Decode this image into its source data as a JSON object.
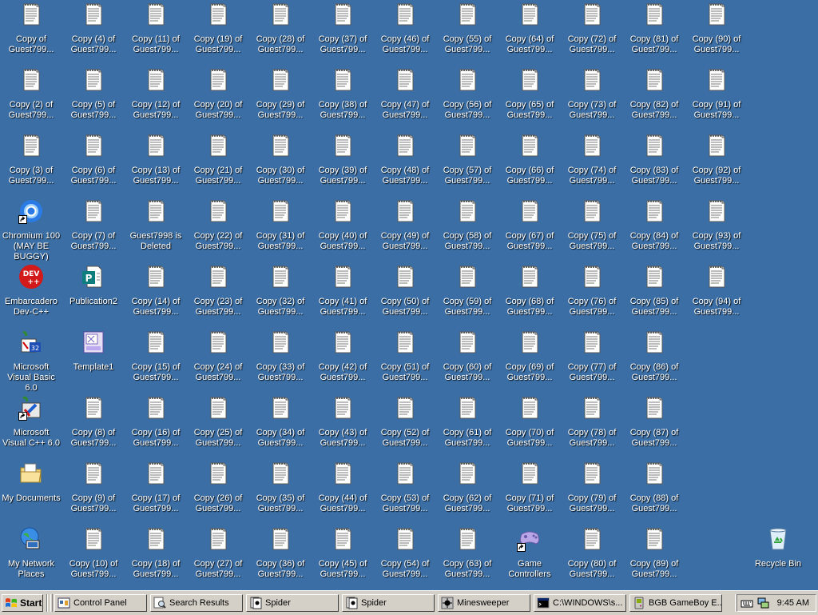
{
  "desktop": {
    "columns": [
      [
        {
          "label": "Copy of Guest799...",
          "icon": "notepad-document-icon"
        },
        {
          "label": "Copy (2) of Guest799...",
          "icon": "notepad-document-icon"
        },
        {
          "label": "Copy (3) of Guest799...",
          "icon": "notepad-document-icon"
        },
        {
          "label": "Chromium 100 (MAY BE BUGGY)",
          "icon": "chromium-icon",
          "shortcut": true
        },
        {
          "label": "Embarcadero Dev-C++",
          "icon": "dev-cpp-icon"
        },
        {
          "label": "Microsoft Visual Basic 6.0",
          "icon": "visual-basic-icon"
        },
        {
          "label": "Microsoft Visual C++ 6.0",
          "icon": "visual-cpp-icon",
          "shortcut": true
        },
        {
          "label": "My Documents",
          "icon": "my-documents-icon"
        },
        {
          "label": "My Network Places",
          "icon": "network-places-icon"
        }
      ],
      [
        {
          "label": "Copy (4) of Guest799...",
          "icon": "notepad-document-icon"
        },
        {
          "label": "Copy (5) of Guest799...",
          "icon": "notepad-document-icon"
        },
        {
          "label": "Copy (6) of Guest799...",
          "icon": "notepad-document-icon"
        },
        {
          "label": "Copy (7) of Guest799...",
          "icon": "notepad-document-icon"
        },
        {
          "label": "Publication2",
          "icon": "publisher-document-icon"
        },
        {
          "label": "Template1",
          "icon": "template-icon"
        },
        {
          "label": "Copy (8) of Guest799...",
          "icon": "notepad-document-icon"
        },
        {
          "label": "Copy (9) of Guest799...",
          "icon": "notepad-document-icon"
        },
        {
          "label": "Copy (10) of Guest799...",
          "icon": "notepad-document-icon"
        }
      ],
      [
        {
          "label": "Copy (11) of Guest799...",
          "icon": "notepad-document-icon"
        },
        {
          "label": "Copy (12) of Guest799...",
          "icon": "notepad-document-icon"
        },
        {
          "label": "Copy (13) of Guest799...",
          "icon": "notepad-document-icon"
        },
        {
          "label": "Guest7998 is Deleted",
          "icon": "notepad-document-icon"
        },
        {
          "label": "Copy (14) of Guest799...",
          "icon": "notepad-document-icon"
        },
        {
          "label": "Copy (15) of Guest799...",
          "icon": "notepad-document-icon"
        },
        {
          "label": "Copy (16) of Guest799...",
          "icon": "notepad-document-icon"
        },
        {
          "label": "Copy (17) of Guest799...",
          "icon": "notepad-document-icon"
        },
        {
          "label": "Copy (18) of Guest799...",
          "icon": "notepad-document-icon"
        }
      ],
      [
        {
          "label": "Copy (19) of Guest799...",
          "icon": "notepad-document-icon"
        },
        {
          "label": "Copy (20) of Guest799...",
          "icon": "notepad-document-icon"
        },
        {
          "label": "Copy (21) of Guest799...",
          "icon": "notepad-document-icon"
        },
        {
          "label": "Copy (22) of Guest799...",
          "icon": "notepad-document-icon"
        },
        {
          "label": "Copy (23) of Guest799...",
          "icon": "notepad-document-icon"
        },
        {
          "label": "Copy (24) of Guest799...",
          "icon": "notepad-document-icon"
        },
        {
          "label": "Copy (25) of Guest799...",
          "icon": "notepad-document-icon"
        },
        {
          "label": "Copy (26) of Guest799...",
          "icon": "notepad-document-icon"
        },
        {
          "label": "Copy (27) of Guest799...",
          "icon": "notepad-document-icon"
        }
      ],
      [
        {
          "label": "Copy (28) of Guest799...",
          "icon": "notepad-document-icon"
        },
        {
          "label": "Copy (29) of Guest799...",
          "icon": "notepad-document-icon"
        },
        {
          "label": "Copy (30) of Guest799...",
          "icon": "notepad-document-icon"
        },
        {
          "label": "Copy (31) of Guest799...",
          "icon": "notepad-document-icon"
        },
        {
          "label": "Copy (32) of Guest799...",
          "icon": "notepad-document-icon"
        },
        {
          "label": "Copy (33) of Guest799...",
          "icon": "notepad-document-icon"
        },
        {
          "label": "Copy (34) of Guest799...",
          "icon": "notepad-document-icon"
        },
        {
          "label": "Copy (35) of Guest799...",
          "icon": "notepad-document-icon"
        },
        {
          "label": "Copy (36) of Guest799...",
          "icon": "notepad-document-icon"
        }
      ],
      [
        {
          "label": "Copy (37) of Guest799...",
          "icon": "notepad-document-icon"
        },
        {
          "label": "Copy (38) of Guest799...",
          "icon": "notepad-document-icon"
        },
        {
          "label": "Copy (39) of Guest799...",
          "icon": "notepad-document-icon"
        },
        {
          "label": "Copy (40) of Guest799...",
          "icon": "notepad-document-icon"
        },
        {
          "label": "Copy (41) of Guest799...",
          "icon": "notepad-document-icon"
        },
        {
          "label": "Copy (42) of Guest799...",
          "icon": "notepad-document-icon"
        },
        {
          "label": "Copy (43) of Guest799...",
          "icon": "notepad-document-icon"
        },
        {
          "label": "Copy (44) of Guest799...",
          "icon": "notepad-document-icon"
        },
        {
          "label": "Copy (45) of Guest799...",
          "icon": "notepad-document-icon"
        }
      ],
      [
        {
          "label": "Copy (46) of Guest799...",
          "icon": "notepad-document-icon"
        },
        {
          "label": "Copy (47) of Guest799...",
          "icon": "notepad-document-icon"
        },
        {
          "label": "Copy (48) of Guest799...",
          "icon": "notepad-document-icon"
        },
        {
          "label": "Copy (49) of Guest799...",
          "icon": "notepad-document-icon"
        },
        {
          "label": "Copy (50) of Guest799...",
          "icon": "notepad-document-icon"
        },
        {
          "label": "Copy (51) of Guest799...",
          "icon": "notepad-document-icon"
        },
        {
          "label": "Copy (52) of Guest799...",
          "icon": "notepad-document-icon"
        },
        {
          "label": "Copy (53) of Guest799...",
          "icon": "notepad-document-icon"
        },
        {
          "label": "Copy (54) of Guest799...",
          "icon": "notepad-document-icon"
        }
      ],
      [
        {
          "label": "Copy (55) of Guest799...",
          "icon": "notepad-document-icon"
        },
        {
          "label": "Copy (56) of Guest799...",
          "icon": "notepad-document-icon"
        },
        {
          "label": "Copy (57) of Guest799...",
          "icon": "notepad-document-icon"
        },
        {
          "label": "Copy (58) of Guest799...",
          "icon": "notepad-document-icon"
        },
        {
          "label": "Copy (59) of Guest799...",
          "icon": "notepad-document-icon"
        },
        {
          "label": "Copy (60) of Guest799...",
          "icon": "notepad-document-icon"
        },
        {
          "label": "Copy (61) of Guest799...",
          "icon": "notepad-document-icon"
        },
        {
          "label": "Copy (62) of Guest799...",
          "icon": "notepad-document-icon"
        },
        {
          "label": "Copy (63) of Guest799...",
          "icon": "notepad-document-icon"
        }
      ],
      [
        {
          "label": "Copy (64) of Guest799...",
          "icon": "notepad-document-icon"
        },
        {
          "label": "Copy (65) of Guest799...",
          "icon": "notepad-document-icon"
        },
        {
          "label": "Copy (66) of Guest799...",
          "icon": "notepad-document-icon"
        },
        {
          "label": "Copy (67) of Guest799...",
          "icon": "notepad-document-icon"
        },
        {
          "label": "Copy (68) of Guest799...",
          "icon": "notepad-document-icon"
        },
        {
          "label": "Copy (69) of Guest799...",
          "icon": "notepad-document-icon"
        },
        {
          "label": "Copy (70) of Guest799...",
          "icon": "notepad-document-icon"
        },
        {
          "label": "Copy (71) of Guest799...",
          "icon": "notepad-document-icon"
        },
        {
          "label": "Game Controllers",
          "icon": "game-controller-icon",
          "shortcut": true
        }
      ],
      [
        {
          "label": "Copy (72) of Guest799...",
          "icon": "notepad-document-icon"
        },
        {
          "label": "Copy (73) of Guest799...",
          "icon": "notepad-document-icon"
        },
        {
          "label": "Copy (74) of Guest799...",
          "icon": "notepad-document-icon"
        },
        {
          "label": "Copy (75) of Guest799...",
          "icon": "notepad-document-icon"
        },
        {
          "label": "Copy (76) of Guest799...",
          "icon": "notepad-document-icon"
        },
        {
          "label": "Copy (77) of Guest799...",
          "icon": "notepad-document-icon"
        },
        {
          "label": "Copy (78) of Guest799...",
          "icon": "notepad-document-icon"
        },
        {
          "label": "Copy (79) of Guest799...",
          "icon": "notepad-document-icon"
        },
        {
          "label": "Copy (80) of Guest799...",
          "icon": "notepad-document-icon"
        }
      ],
      [
        {
          "label": "Copy (81) of Guest799...",
          "icon": "notepad-document-icon"
        },
        {
          "label": "Copy (82) of Guest799...",
          "icon": "notepad-document-icon"
        },
        {
          "label": "Copy (83) of Guest799...",
          "icon": "notepad-document-icon"
        },
        {
          "label": "Copy (84) of Guest799...",
          "icon": "notepad-document-icon"
        },
        {
          "label": "Copy (85) of Guest799...",
          "icon": "notepad-document-icon"
        },
        {
          "label": "Copy (86) of Guest799...",
          "icon": "notepad-document-icon"
        },
        {
          "label": "Copy (87) of Guest799...",
          "icon": "notepad-document-icon"
        },
        {
          "label": "Copy (88) of Guest799...",
          "icon": "notepad-document-icon"
        },
        {
          "label": "Copy (89) of Guest799...",
          "icon": "notepad-document-icon"
        }
      ],
      [
        {
          "label": "Copy (90) of Guest799...",
          "icon": "notepad-document-icon"
        },
        {
          "label": "Copy (91) of Guest799...",
          "icon": "notepad-document-icon"
        },
        {
          "label": "Copy (92) of Guest799...",
          "icon": "notepad-document-icon"
        },
        {
          "label": "Copy (93) of Guest799...",
          "icon": "notepad-document-icon"
        },
        {
          "label": "Copy (94) of Guest799...",
          "icon": "notepad-document-icon"
        }
      ]
    ],
    "recycle_bin": {
      "label": "Recycle Bin",
      "icon": "recycle-bin-icon"
    }
  },
  "taskbar": {
    "start_label": "Start",
    "tasks": [
      {
        "label": "Control Panel",
        "icon": "control-panel-icon"
      },
      {
        "label": "Search Results",
        "icon": "search-icon"
      },
      {
        "label": "Spider",
        "icon": "spider-solitaire-icon"
      },
      {
        "label": "Spider",
        "icon": "spider-solitaire-icon"
      },
      {
        "label": "Minesweeper",
        "icon": "minesweeper-icon"
      },
      {
        "label": "C:\\WINDOWS\\s...",
        "icon": "command-prompt-icon"
      },
      {
        "label": "BGB GameBoy E...",
        "icon": "gameboy-emulator-icon"
      }
    ],
    "tray": {
      "clock": "9:45 AM",
      "icons": [
        "keyboard-icon",
        "network-tray-icon"
      ]
    }
  },
  "colors": {
    "desktop_background": "#3a6ea5",
    "taskbar": "#d4d0c8",
    "label_text": "#ffffff"
  }
}
